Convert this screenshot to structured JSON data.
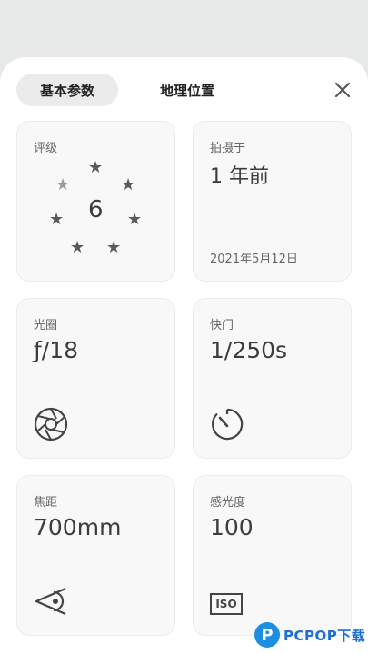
{
  "tabs": [
    {
      "label": "基本参数",
      "active": true
    },
    {
      "label": "地理位置",
      "active": false
    }
  ],
  "rating": {
    "label": "评级",
    "value": "6",
    "stars_total": 7,
    "stars_filled": 6
  },
  "taken": {
    "label": "拍摄于",
    "value": "1 年前",
    "date": "2021年5月12日"
  },
  "aperture": {
    "label": "光圈",
    "value": "ƒ/18",
    "icon": "aperture-icon"
  },
  "shutter": {
    "label": "快门",
    "value": "1/250s",
    "icon": "timer-icon"
  },
  "focal": {
    "label": "焦距",
    "value": "700mm",
    "icon": "eye-view-icon"
  },
  "iso": {
    "label": "感光度",
    "value": "100",
    "icon": "iso-icon",
    "icon_text": "ISO"
  },
  "watermark": {
    "logo": "P",
    "text": "PCPOP下载"
  }
}
